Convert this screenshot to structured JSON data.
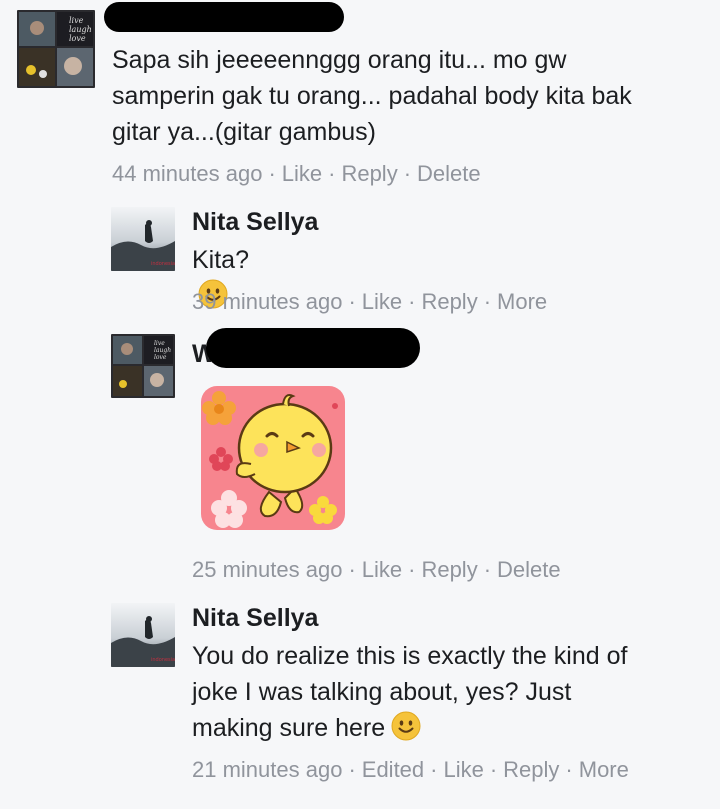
{
  "comments": [
    {
      "id": "c1",
      "author": "",
      "text": "Sapa sih jeeeeennggg orang itu... mo gw samperin gak tu orang... padahal body kita bak gitar ya...(gitar gambus)",
      "time": "44 minutes ago",
      "actions": [
        "Like",
        "Reply",
        "Delete"
      ],
      "author_redacted": true
    },
    {
      "id": "c2",
      "author": "Nita Sellya",
      "text": "Kita?",
      "emoji": "smiley-emoji",
      "time": "39 minutes ago",
      "actions": [
        "Like",
        "Reply",
        "More"
      ]
    },
    {
      "id": "c3",
      "author": "W",
      "text": "",
      "sticker": "chick-sticker",
      "time": "25 minutes ago",
      "actions": [
        "Like",
        "Reply",
        "Delete"
      ],
      "author_redacted": true
    },
    {
      "id": "c4",
      "author": "Nita Sellya",
      "text_lines": [
        "You do realize this is exactly the kind of",
        "joke I was talking about, yes? Just",
        "making sure here"
      ],
      "emoji": "smiley-emoji",
      "time": "21 minutes ago",
      "actions": [
        "Edited",
        "Like",
        "Reply",
        "More"
      ]
    }
  ],
  "avatar_art": {
    "live_laugh_love_text": [
      "live",
      "laugh",
      "love"
    ]
  },
  "colors": {
    "background": "#f6f7f9",
    "meta": "#90949c",
    "text": "#1c1e21",
    "sticker_bg": "#f7858e",
    "chick": "#fde35a"
  }
}
